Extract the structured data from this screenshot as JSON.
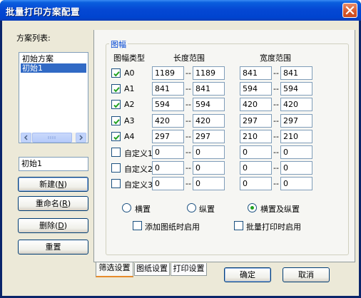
{
  "window": {
    "title": "批量打印方案配置"
  },
  "scheme_list": {
    "label": "方案列表:",
    "items": [
      "初始方案",
      "初始1"
    ],
    "selected_index": 1,
    "name_value": "初始1"
  },
  "buttons": {
    "new": "新建(",
    "new_key": "N",
    "new_end": ")",
    "rename": "重命名(",
    "rename_key": "R",
    "rename_end": ")",
    "delete": "删除(",
    "delete_key": "D",
    "delete_end": ")",
    "reset": "重置",
    "ok": "确定",
    "cancel": "取消"
  },
  "group": {
    "title": "图幅",
    "headers": {
      "type": "图幅类型",
      "length": "长度范围",
      "width": "宽度范围"
    },
    "sep": "--",
    "rows": [
      {
        "name": "A0",
        "checked": true,
        "len_min": "1189",
        "len_max": "1189",
        "wid_min": "841",
        "wid_max": "841"
      },
      {
        "name": "A1",
        "checked": true,
        "len_min": "841",
        "len_max": "841",
        "wid_min": "594",
        "wid_max": "594"
      },
      {
        "name": "A2",
        "checked": true,
        "len_min": "594",
        "len_max": "594",
        "wid_min": "420",
        "wid_max": "420"
      },
      {
        "name": "A3",
        "checked": true,
        "len_min": "420",
        "len_max": "420",
        "wid_min": "297",
        "wid_max": "297"
      },
      {
        "name": "A4",
        "checked": true,
        "len_min": "297",
        "len_max": "297",
        "wid_min": "210",
        "wid_max": "210"
      },
      {
        "name": "自定义1",
        "checked": false,
        "len_min": "0",
        "len_max": "0",
        "wid_min": "0",
        "wid_max": "0"
      },
      {
        "name": "自定义2",
        "checked": false,
        "len_min": "0",
        "len_max": "0",
        "wid_min": "0",
        "wid_max": "0"
      },
      {
        "name": "自定义3",
        "checked": false,
        "len_min": "0",
        "len_max": "0",
        "wid_min": "0",
        "wid_max": "0"
      }
    ]
  },
  "orientation": {
    "options": [
      "横置",
      "纵置",
      "横置及纵置"
    ],
    "selected_index": 2
  },
  "options": {
    "add_sheet": {
      "label": "添加图纸时启用",
      "checked": false
    },
    "batch_print": {
      "label": "批量打印时启用",
      "checked": false
    }
  },
  "tabs": [
    "筛选设置",
    "图纸设置",
    "打印设置"
  ],
  "active_tab": 0,
  "colors": {
    "title_bar": "#0548d4",
    "selection": "#316ac5",
    "group_title": "#0046d5",
    "check": "#21a121"
  }
}
